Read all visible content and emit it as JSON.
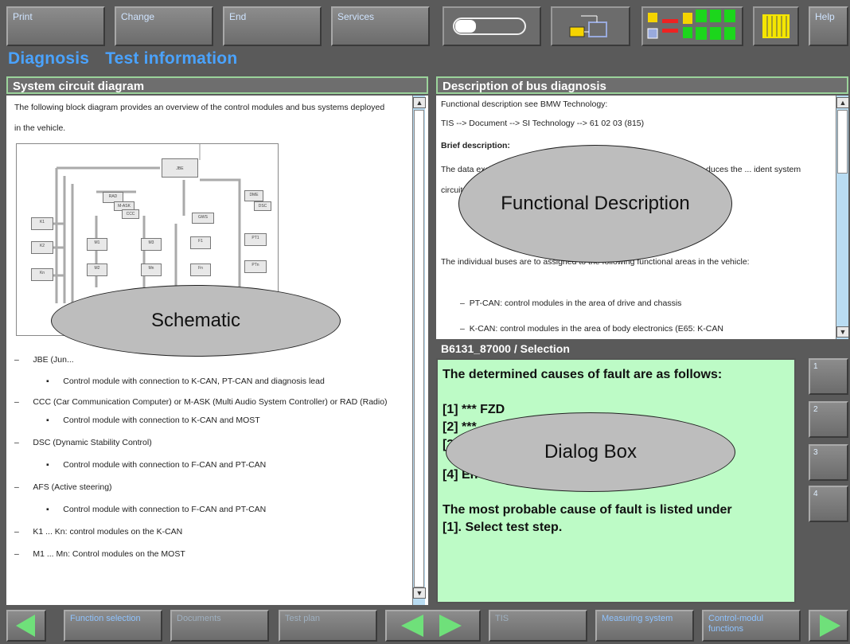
{
  "toolbar": {
    "print": "Print",
    "change": "Change",
    "end": "End",
    "services": "Services",
    "help": "Help",
    "icons": [
      "battery-icon",
      "connection-icon",
      "status-blocks-icon",
      "fuse-icon"
    ]
  },
  "title": {
    "left": "Diagnosis",
    "right": "Test information"
  },
  "left_panel": {
    "header": "System circuit diagram",
    "intro": "The following block diagram provides an overview of the control modules and bus systems deployed in the vehicle.",
    "items": [
      {
        "kind": "dash",
        "text": "JBE (Jun..."
      },
      {
        "kind": "bullet",
        "text": "Control module with connection to K-CAN, PT-CAN and diagnosis lead"
      },
      {
        "kind": "dash",
        "text": "CCC (Car Communication Computer) or M-ASK (Multi Audio System Controller) or RAD (Radio)"
      },
      {
        "kind": "bullet",
        "text": "Control module with connection to K-CAN and MOST"
      },
      {
        "kind": "dash",
        "text": "DSC (Dynamic Stability Control)"
      },
      {
        "kind": "bullet",
        "text": "Control module with connection to F-CAN and PT-CAN"
      },
      {
        "kind": "dash",
        "text": "AFS (Active steering)"
      },
      {
        "kind": "bullet",
        "text": "Control module with connection to F-CAN and PT-CAN"
      },
      {
        "kind": "dash",
        "text": "K1 ... Kn: control modules on the K-CAN"
      },
      {
        "kind": "dash",
        "text": "M1 ... Mn: Control modules on the MOST"
      }
    ],
    "annotation": "Schematic"
  },
  "right_panel": {
    "header": "Description of bus diagnosis",
    "line1": "Functional description see BMW Technology:",
    "line2": "TIS --> Document --> SI Technology --> 61 02 03 (815)",
    "brief": "Brief description:",
    "para1": "The data exchange ... various bus systems with different ... so-called ... duces the ... ident system circuit diagram.",
    "para2": "The individual buses are to assigned to the following functional areas in the vehicle:",
    "bullet1": "PT-CAN: control modules in the area of drive and chassis",
    "bullet2": "K-CAN: control modules in the area of body electronics (E65: K-CAN",
    "annotation": "Functional Description"
  },
  "dialog": {
    "header": "B6131_87000 / Selection",
    "line1": "The determined causes of fault are as follows:",
    "line2": "[1] ***   FZD",
    "line3": "[2] ***",
    "line4": "[3]",
    "line5": "[4] En",
    "line6": "The most probable cause of fault is listed under",
    "line7": "[1]. Select test step.",
    "side_buttons": [
      "1",
      "2",
      "3",
      "4"
    ],
    "annotation": "Dialog Box"
  },
  "bottom": {
    "function_selection": "Function selection",
    "documents": "Documents",
    "test_plan": "Test plan",
    "tis": "TIS",
    "measuring_system": "Measuring system",
    "control_module_functions": "Control-modul functions"
  },
  "colors": {
    "accent": "#4aa3ff",
    "dialog_bg": "#bdfbc6",
    "arrow_green": "#6fe07a"
  }
}
